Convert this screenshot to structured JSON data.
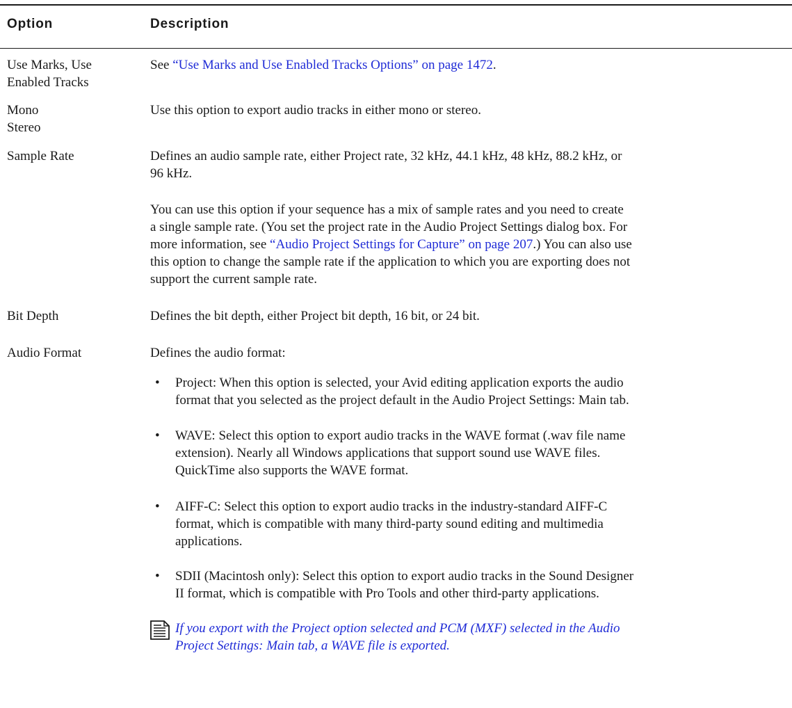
{
  "table": {
    "headers": {
      "option": "Option",
      "description": "Description"
    },
    "rows": {
      "use_marks": {
        "option": [
          "Use Marks, Use",
          "Enabled Tracks"
        ],
        "see": "See ",
        "link": "“Use Marks and Use Enabled Tracks Options” on page 1472",
        "period": "."
      },
      "mono": {
        "option": [
          "Mono",
          "Stereo"
        ],
        "description": "Use this option to export audio tracks in either mono or stereo."
      },
      "sample_rate": {
        "option": "Sample Rate",
        "p1": [
          "Defines an audio sample rate, either Project rate, 32 kHz, 44.1 kHz, 48 kHz, 88.2 kHz, or",
          "96 kHz."
        ],
        "p2_line1": "You can use this option if your sequence has a mix of sample rates and you need to create",
        "p2_line2": "a single sample rate. (You set the project rate in the Audio Project Settings dialog box. For",
        "p2_line3_pre": "more information, see ",
        "p2_line3_link": "“Audio Project Settings for Capture” on page 207",
        "p2_line3_post": ".) You can also use",
        "p2_line4": "this option to change the sample rate if the application to which you are exporting does not",
        "p2_line5": "support the current sample rate."
      },
      "bit_depth": {
        "option": "Bit Depth",
        "description": "Defines the bit depth, either Project bit depth, 16 bit, or 24 bit."
      },
      "audio_format": {
        "option": "Audio Format",
        "intro": "Defines the audio format:",
        "bullet_char": "•",
        "bullets": [
          [
            "Project: When this option is selected, your Avid editing application exports the audio",
            "format that you selected as the project default in the Audio Project Settings: Main tab."
          ],
          [
            "WAVE: Select this option to export audio tracks in the WAVE format (.wav file name",
            "extension). Nearly all Windows applications that support sound use WAVE files.",
            "QuickTime also supports the WAVE format."
          ],
          [
            "AIFF-C: Select this option to export audio tracks in the industry-standard AIFF-C",
            "format, which is compatible with many third-party sound editing and multimedia",
            "applications."
          ],
          [
            "SDII (Macintosh only): Select this option to export audio tracks in the Sound Designer",
            "II format, which is compatible with Pro Tools and other third-party applications."
          ]
        ],
        "note": {
          "icon": "note-icon",
          "lines": [
            "If you export with the Project option selected and PCM (MXF) selected in the Audio",
            "Project Settings: Main tab, a WAVE file is exported."
          ]
        }
      }
    }
  },
  "colors": {
    "link": "#1f2bd6",
    "text": "#1a1a1a",
    "rule": "#1a1a1a"
  }
}
